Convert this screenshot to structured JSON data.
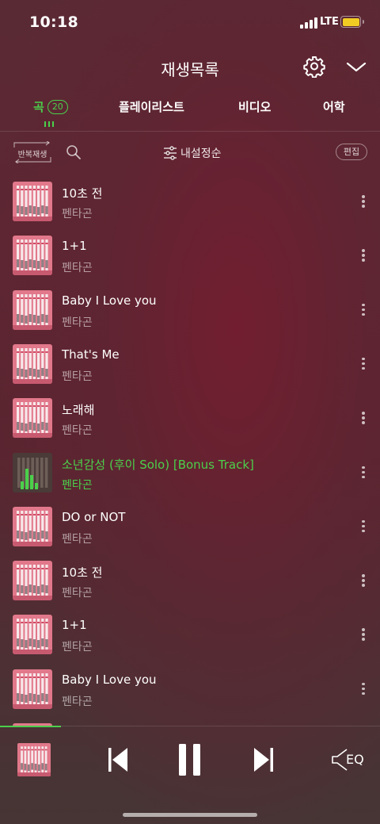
{
  "status_bar": {
    "time": "10:18",
    "network": "LTE"
  },
  "header": {
    "title": "재생목록",
    "icons": [
      "settings-gear-icon",
      "chevron-down-icon"
    ]
  },
  "tabs": [
    {
      "label": "곡",
      "count": "20",
      "active": true
    },
    {
      "label": "플레이리스트",
      "active": false
    },
    {
      "label": "비디오",
      "active": false
    },
    {
      "label": "어학",
      "active": false
    }
  ],
  "toolbar": {
    "repeat_label": "반복재생",
    "sort_label": "내설정순",
    "edit_label": "편집"
  },
  "tracks": [
    {
      "title": "10초 전",
      "artist": "펜타곤",
      "playing": false
    },
    {
      "title": "1+1",
      "artist": "펜타곤",
      "playing": false
    },
    {
      "title": "Baby I Love you",
      "artist": "펜타곤",
      "playing": false
    },
    {
      "title": "That's Me",
      "artist": "펜타곤",
      "playing": false
    },
    {
      "title": "노래해",
      "artist": "펜타곤",
      "playing": false
    },
    {
      "title": "소년감성 (후이 Solo) [Bonus Track]",
      "artist": "펜타곤",
      "playing": true
    },
    {
      "title": "DO or NOT",
      "artist": "펜타곤",
      "playing": false
    },
    {
      "title": "10초 전",
      "artist": "펜타곤",
      "playing": false
    },
    {
      "title": "1+1",
      "artist": "펜타곤",
      "playing": false
    },
    {
      "title": "Baby I Love you",
      "artist": "펜타곤",
      "playing": false
    }
  ],
  "player": {
    "progress": 0.16,
    "eq_label": "EQ"
  },
  "colors": {
    "accent": "#4bd04b",
    "thumb_pink": "#e2788b"
  }
}
